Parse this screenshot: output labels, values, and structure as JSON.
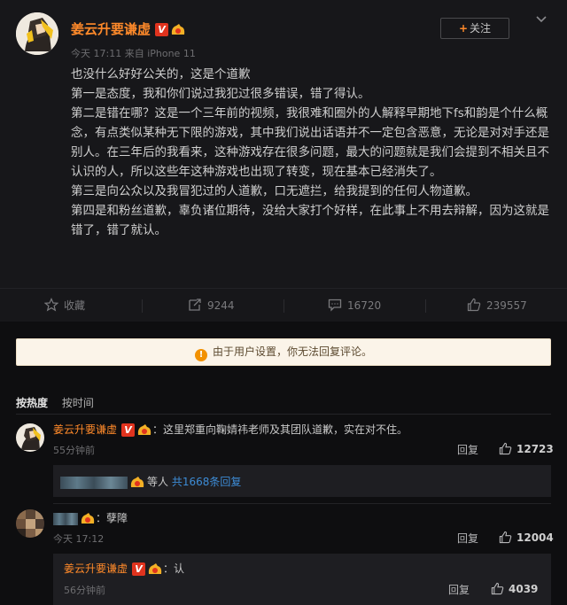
{
  "post": {
    "username": "姜云升要谦虚",
    "vbadge": "V",
    "meta": "今天 17:11 来自 iPhone 11",
    "follow_label": "关注",
    "follow_plus": "+",
    "paragraphs": [
      "也没什么好好公关的，这是个道歉",
      "第一是态度，我和你们说过我犯过很多错误，错了得认。",
      "第二是错在哪？这是一个三年前的视频，我很难和圈外的人解释早期地下fs和韵是个什么概念，有点类似某种无下限的游戏，其中我们说出话语并不一定包含恶意，无论是对对手还是别人。在三年后的我看来，这种游戏存在很多问题，最大的问题就是我们会提到不相关且不认识的人，所以这些年这种游戏也出现了转变，现在基本已经消失了。",
      "第三是向公众以及我冒犯过的人道歉，口无遮拦，给我提到的任何人物道歉。",
      "第四是和粉丝道歉，辜负诸位期待，没给大家打个好样，在此事上不用去辩解，因为这就是错了，错了就认。"
    ]
  },
  "actions": {
    "favorite_label": "收藏",
    "repost_count": "9244",
    "comment_count": "16720",
    "like_count": "239557"
  },
  "notice": {
    "icon": "!",
    "text": "由于用户设置，你无法回复评论。"
  },
  "sort": {
    "hot": "按热度",
    "time": "按时间"
  },
  "comments": [
    {
      "username": "姜云升要谦虚",
      "vbadge": "V",
      "text": "：这里郑重向鞠婧祎老师及其团队道歉，实在对不住。",
      "time": "55分钟前",
      "reply_label": "回复",
      "likes": "12723",
      "reply_summary": {
        "others": "等人",
        "link": "共1668条回复"
      }
    },
    {
      "text": "：孽障",
      "time": "今天 17:12",
      "reply_label": "回复",
      "likes": "12004",
      "reply": {
        "username": "姜云升要谦虚",
        "vbadge": "V",
        "text": "：认",
        "time": "56分钟前",
        "reply_label": "回复",
        "likes": "4039"
      }
    }
  ],
  "colors": {
    "background": "#0e0e10",
    "card": "#17171a",
    "username": "#ff8a2a",
    "link": "#3d8cd6",
    "notice_bg": "#fbf4e9"
  }
}
